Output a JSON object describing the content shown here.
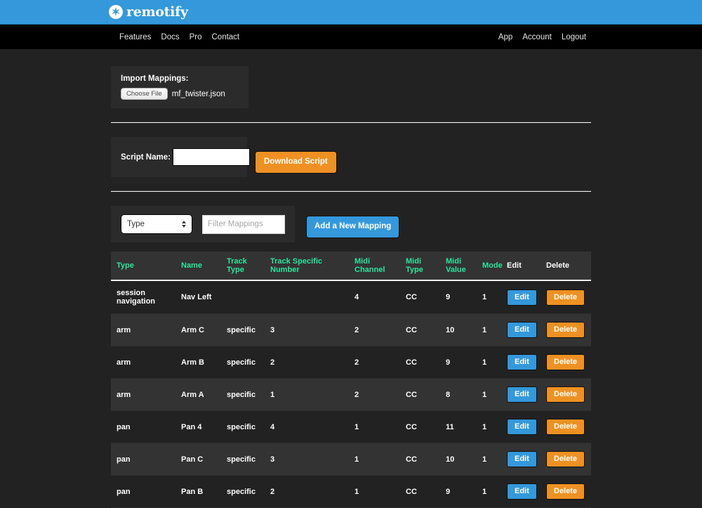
{
  "brand": {
    "name": "remotify",
    "logo_icon": "gear-icon"
  },
  "nav": {
    "left_links": [
      {
        "label": "Features"
      },
      {
        "label": "Docs"
      },
      {
        "label": "Pro"
      },
      {
        "label": "Contact"
      }
    ],
    "right_links": [
      {
        "label": "App"
      },
      {
        "label": "Account"
      },
      {
        "label": "Logout"
      }
    ]
  },
  "import": {
    "label": "Import Mappings:",
    "choose_file_label": "Choose File",
    "file_name": "mf_twister.json"
  },
  "script": {
    "label": "Script Name:",
    "input_value": "",
    "input_placeholder": "",
    "download_label": "Download Script"
  },
  "filter": {
    "type_select_value": "Type",
    "filter_placeholder": "Filter Mappings",
    "filter_value": "",
    "add_mapping_label": "Add a New Mapping"
  },
  "table": {
    "columns": [
      {
        "label": "Type",
        "style": "accent"
      },
      {
        "label": "Name",
        "style": "accent"
      },
      {
        "label": "Track Type",
        "style": "accent"
      },
      {
        "label": "Track Specific Number",
        "style": "accent"
      },
      {
        "label": "Midi Channel",
        "style": "accent"
      },
      {
        "label": "Midi Type",
        "style": "accent"
      },
      {
        "label": "Midi Value",
        "style": "accent"
      },
      {
        "label": "Mode",
        "style": "accent"
      },
      {
        "label": "Edit",
        "style": "plain"
      },
      {
        "label": "Delete",
        "style": "plain"
      }
    ],
    "edit_label": "Edit",
    "delete_label": "Delete",
    "rows": [
      {
        "type": "session navigation",
        "name": "Nav Left",
        "track_type": "",
        "track_specific_number": "",
        "midi_channel": "4",
        "midi_type": "CC",
        "midi_value": "9",
        "mode": "1"
      },
      {
        "type": "arm",
        "name": "Arm C",
        "track_type": "specific",
        "track_specific_number": "3",
        "midi_channel": "2",
        "midi_type": "CC",
        "midi_value": "10",
        "mode": "1"
      },
      {
        "type": "arm",
        "name": "Arm B",
        "track_type": "specific",
        "track_specific_number": "2",
        "midi_channel": "2",
        "midi_type": "CC",
        "midi_value": "9",
        "mode": "1"
      },
      {
        "type": "arm",
        "name": "Arm A",
        "track_type": "specific",
        "track_specific_number": "1",
        "midi_channel": "2",
        "midi_type": "CC",
        "midi_value": "8",
        "mode": "1"
      },
      {
        "type": "pan",
        "name": "Pan 4",
        "track_type": "specific",
        "track_specific_number": "4",
        "midi_channel": "1",
        "midi_type": "CC",
        "midi_value": "11",
        "mode": "1"
      },
      {
        "type": "pan",
        "name": "Pan C",
        "track_type": "specific",
        "track_specific_number": "3",
        "midi_channel": "1",
        "midi_type": "CC",
        "midi_value": "10",
        "mode": "1"
      },
      {
        "type": "pan",
        "name": "Pan B",
        "track_type": "specific",
        "track_specific_number": "2",
        "midi_channel": "1",
        "midi_type": "CC",
        "midi_value": "9",
        "mode": "1"
      }
    ]
  },
  "colors": {
    "brand_blue": "#3498db",
    "accent_green": "#2ee59d",
    "orange": "#ef9122",
    "body_bg": "#222222",
    "panel_bg": "#2b2b2b",
    "row_alt_bg": "#333333"
  }
}
